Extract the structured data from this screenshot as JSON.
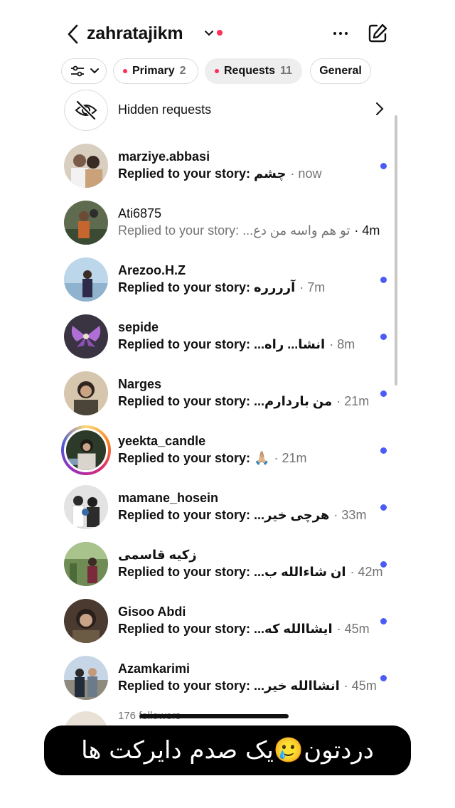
{
  "header": {
    "username": "zahratajikm"
  },
  "filters": {
    "primary_label": "Primary",
    "primary_count": "2",
    "requests_label": "Requests",
    "requests_count": "11",
    "general_label": "General"
  },
  "hidden_requests": {
    "label": "Hidden requests"
  },
  "conversations": [
    {
      "name": "marziye.abbasi",
      "prefix": "Replied to your story:",
      "message": "چشم",
      "time": "· now",
      "unread": true
    },
    {
      "name": "Ati6875",
      "prefix": "Replied to your story:",
      "message": "تو هم واسه من دع...",
      "time": "· 4m",
      "unread": false
    },
    {
      "name": "Arezoo.H.Z",
      "prefix": "Replied to your story:",
      "message": "آرررره",
      "time": "· 7m",
      "unread": true
    },
    {
      "name": "sepide",
      "prefix": "Replied to your story:",
      "message": "انشا... راه...",
      "time": "· 8m",
      "unread": true
    },
    {
      "name": "Narges",
      "prefix": "Replied to your story:",
      "message": "من باردارم...",
      "time": "· 21m",
      "unread": true
    },
    {
      "name": "yeekta_candle",
      "prefix": "Replied to your story:",
      "message": "🙏🏼",
      "time": "· 21m",
      "unread": true
    },
    {
      "name": "mamane_hosein",
      "prefix": "Replied to your story:",
      "message": "هرچی خیر...",
      "time": "· 33m",
      "unread": true
    },
    {
      "name": "زکیه قاسمی",
      "prefix": "Replied to your story:",
      "message": "ان شاءالله ب...",
      "time": "· 42m",
      "unread": true
    },
    {
      "name": "Gisoo Abdi",
      "prefix": "Replied to your story:",
      "message": "ایشاالله که...",
      "time": "· 45m",
      "unread": true
    },
    {
      "name": "Azamkarimi",
      "prefix": "Replied to your story:",
      "message": "انشاالله خیر...",
      "time": "· 45m",
      "unread": true
    }
  ],
  "footer": {
    "followers_text": "176 followers"
  },
  "caption": {
    "text": "دردتون🥲یک صدم دایرکت ها"
  },
  "colors": {
    "unread_dot": "#4a5cf5",
    "notification_dot": "#ff2f55"
  }
}
